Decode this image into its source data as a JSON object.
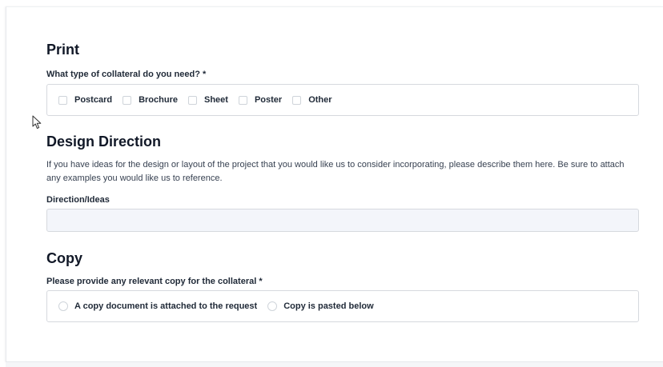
{
  "print": {
    "title": "Print",
    "question": "What type of collateral do you need? *",
    "options": [
      "Postcard",
      "Brochure",
      "Sheet",
      "Poster",
      "Other"
    ]
  },
  "design": {
    "title": "Design Direction",
    "help": "If you have ideas for the design or layout of the project that you would like us to consider incorporating, please describe them here. Be sure to attach any examples you would like us to reference.",
    "field_label": "Direction/Ideas",
    "field_value": ""
  },
  "copy": {
    "title": "Copy",
    "question": "Please provide any relevant copy for the collateral *",
    "options": [
      "A copy document is attached to the request",
      "Copy is pasted below"
    ]
  },
  "icons": {
    "cursor": "mouse-pointer-icon"
  }
}
